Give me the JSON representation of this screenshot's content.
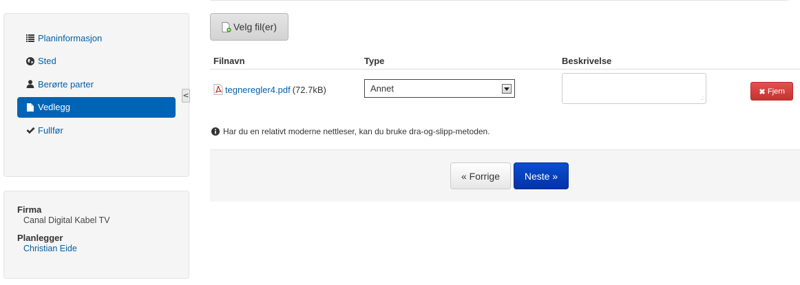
{
  "nav": {
    "items": [
      {
        "label": "Planinformasjon",
        "icon": "list-icon"
      },
      {
        "label": "Sted",
        "icon": "globe-icon"
      },
      {
        "label": "Berørte parter",
        "icon": "user-icon"
      },
      {
        "label": "Vedlegg",
        "icon": "file-icon",
        "active": true
      },
      {
        "label": "Fullfør",
        "icon": "check-icon"
      }
    ],
    "collapse_label": "<"
  },
  "info": {
    "company_label": "Firma",
    "company_value": "Canal Digital Kabel TV",
    "planner_label": "Planlegger",
    "planner_value": "Christian Eide"
  },
  "upload": {
    "choose_label": "Velg fil(er)"
  },
  "table": {
    "headers": {
      "filename": "Filnavn",
      "type": "Type",
      "description": "Beskrivelse"
    },
    "rows": [
      {
        "filename": "tegneregler4.pdf",
        "size": "(72.7kB)",
        "type": "Annet",
        "description": "",
        "remove_label": "Fjern"
      }
    ]
  },
  "hint": "Har du en relativt moderne nettleser, kan du bruke dra-og-slipp-metoden.",
  "pager": {
    "prev_label": "« Forrige",
    "next_label": "Neste »"
  },
  "colors": {
    "accent": "#0064b4",
    "danger": "#d9534f",
    "primary_button": "#0232a8"
  }
}
